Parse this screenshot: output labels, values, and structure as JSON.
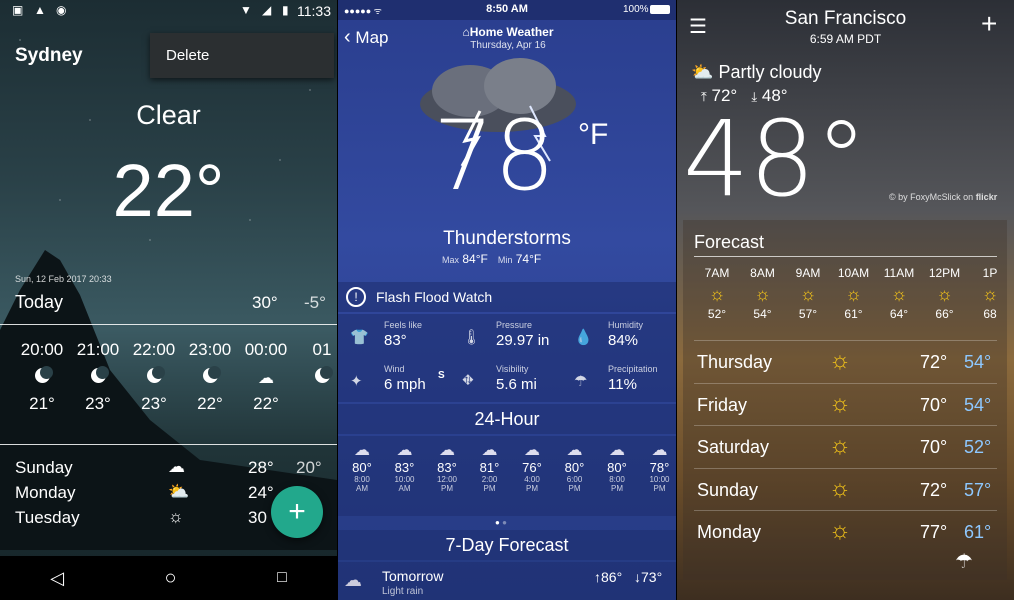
{
  "android": {
    "status": {
      "time": "11:33"
    },
    "city": "Sydney",
    "menu_item": "Delete",
    "condition": "Clear",
    "temp": "22°",
    "updated": "Sun, 12 Feb 2017 20:33",
    "today": {
      "label": "Today",
      "high": "30°",
      "low": "-5°"
    },
    "hours": [
      {
        "time": "20:00",
        "icon": "moon-icon",
        "temp": "21°"
      },
      {
        "time": "21:00",
        "icon": "moon-icon",
        "temp": "23°"
      },
      {
        "time": "22:00",
        "icon": "moon-icon",
        "temp": "23°"
      },
      {
        "time": "23:00",
        "icon": "moon-icon",
        "temp": "22°"
      },
      {
        "time": "00:00",
        "icon": "cloudy-night-icon",
        "temp": "22°"
      },
      {
        "time": "01",
        "icon": "moon-icon",
        "temp": ""
      }
    ],
    "days": [
      {
        "name": "Sunday",
        "icon": "cloud-icon",
        "high": "28°",
        "low": "20°"
      },
      {
        "name": "Monday",
        "icon": "partly-cloudy-icon",
        "high": "24°",
        "low": ""
      },
      {
        "name": "Tuesday",
        "icon": "sun-icon",
        "high": "30",
        "low": ""
      }
    ],
    "fab": "+"
  },
  "ios": {
    "status": {
      "time": "8:50 AM",
      "battery": "100%"
    },
    "back": "Map",
    "title": "Home Weather",
    "date": "Thursday, Apr 16",
    "temp": "78",
    "unit": "°F",
    "condition": "Thunderstorms",
    "max_label": "Max",
    "max": "84°F",
    "min_label": "Min",
    "min": "74°F",
    "alert": "Flash Flood Watch",
    "details": [
      {
        "label": "Feels like",
        "value": "83°",
        "icon": "shirt-icon"
      },
      {
        "label": "Pressure",
        "value": "29.97 in",
        "icon": "thermometer-icon"
      },
      {
        "label": "Humidity",
        "value": "84%",
        "icon": "droplets-icon"
      },
      {
        "label": "Wind",
        "value": "6 mph",
        "icon": "compass-icon",
        "extra": "S"
      },
      {
        "label": "Visibility",
        "value": "5.6 mi",
        "icon": "road-icon"
      },
      {
        "label": "Precipitation",
        "value": "11%",
        "icon": "rain-cloud-icon"
      }
    ],
    "hourly_title": "24-Hour",
    "hourly": [
      {
        "temp": "80°",
        "time": "8:00",
        "ampm": "AM"
      },
      {
        "temp": "83°",
        "time": "10:00",
        "ampm": "AM"
      },
      {
        "temp": "83°",
        "time": "12:00",
        "ampm": "PM"
      },
      {
        "temp": "81°",
        "time": "2:00",
        "ampm": "PM"
      },
      {
        "temp": "76°",
        "time": "4:00",
        "ampm": "PM"
      },
      {
        "temp": "80°",
        "time": "6:00",
        "ampm": "PM"
      },
      {
        "temp": "80°",
        "time": "8:00",
        "ampm": "PM"
      },
      {
        "temp": "78°",
        "time": "10:00",
        "ampm": "PM"
      }
    ],
    "forecast_title": "7-Day Forecast",
    "tomorrow": {
      "label": "Tomorrow",
      "sub": "Light rain",
      "hi": "↑86°",
      "lo": "↓73°"
    }
  },
  "yahoo": {
    "city": "San Francisco",
    "time": "6:59 AM PDT",
    "condition": "Partly cloudy",
    "hi": "72°",
    "lo": "48°",
    "temp": "48°",
    "credit": "by FoxyMcSlick on",
    "credit_brand": "flickr",
    "forecast_label": "Forecast",
    "hours": [
      {
        "time": "7AM",
        "temp": "52°"
      },
      {
        "time": "8AM",
        "temp": "54°"
      },
      {
        "time": "9AM",
        "temp": "57°"
      },
      {
        "time": "10AM",
        "temp": "61°"
      },
      {
        "time": "11AM",
        "temp": "64°"
      },
      {
        "time": "12PM",
        "temp": "66°"
      },
      {
        "time": "1P",
        "temp": "68"
      }
    ],
    "days": [
      {
        "name": "Thursday",
        "hi": "72°",
        "lo": "54°"
      },
      {
        "name": "Friday",
        "hi": "70°",
        "lo": "54°"
      },
      {
        "name": "Saturday",
        "hi": "70°",
        "lo": "52°"
      },
      {
        "name": "Sunday",
        "hi": "72°",
        "lo": "57°"
      },
      {
        "name": "Monday",
        "hi": "77°",
        "lo": "61°"
      }
    ],
    "colors": {
      "sun": "#f5c518",
      "lo": "#8ec8ff"
    }
  }
}
